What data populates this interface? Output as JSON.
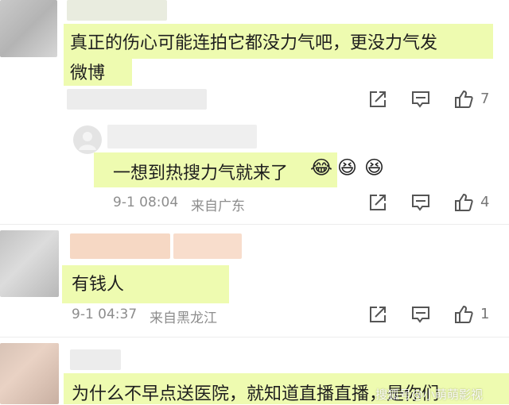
{
  "comments": [
    {
      "text_line1": "真正的伤心可能连拍它都没力气吧，更没力气发",
      "text_line2": "微博",
      "like_count": "7"
    },
    {
      "text": "一想到热搜力气就来了",
      "emojis": [
        "😂",
        "😆",
        "😆"
      ],
      "time": "9-1 08:04",
      "location": "来自广东",
      "like_count": "4"
    },
    {
      "text": "有钱人",
      "time": "9-1 04:37",
      "location": "来自黑龙江",
      "like_count": "1"
    },
    {
      "text": "为什么不早点送医院，就知道直播直播，是你们"
    }
  ],
  "watermark": "搜狐号@小萌萌影视"
}
